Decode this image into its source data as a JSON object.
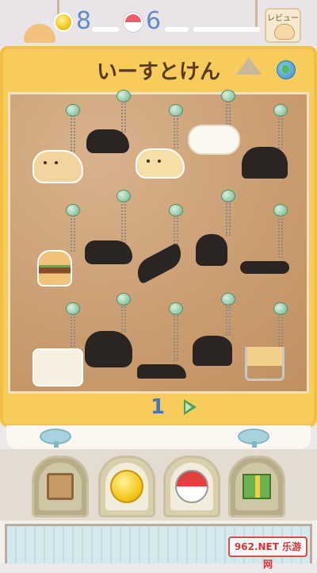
{
  "header": {
    "coins": "8",
    "gachas": "6",
    "review_label": "レビュー"
  },
  "title": "いーすとけん",
  "page": {
    "number": "1"
  },
  "collection": {
    "items": [
      {
        "row": 0,
        "col": 0,
        "state": "owned"
      },
      {
        "row": 0,
        "col": 1,
        "state": "locked"
      },
      {
        "row": 0,
        "col": 2,
        "state": "owned"
      },
      {
        "row": 0,
        "col": 3,
        "state": "owned"
      },
      {
        "row": 1,
        "col": 0,
        "state": "locked"
      },
      {
        "row": 1,
        "col": 1,
        "state": "owned"
      },
      {
        "row": 1,
        "col": 2,
        "state": "locked"
      },
      {
        "row": 1,
        "col": 3,
        "state": "locked"
      },
      {
        "row": 1,
        "col": 4,
        "state": "locked"
      },
      {
        "row": 2,
        "col": 0,
        "state": "owned"
      },
      {
        "row": 2,
        "col": 1,
        "state": "locked"
      },
      {
        "row": 2,
        "col": 2,
        "state": "locked"
      },
      {
        "row": 2,
        "col": 3,
        "state": "locked"
      },
      {
        "row": 2,
        "col": 4,
        "state": "owned"
      }
    ]
  },
  "watermark": "962.NET 乐游网",
  "colors": {
    "frame": "#f7cc5a",
    "board": "#cfa57c",
    "counter": "#5c8dcb",
    "silhouette": "#2a2422"
  },
  "icons": {
    "coin": "coin-icon",
    "gacha": "gacha-capsule-icon",
    "globe": "globe-icon",
    "next": "next-arrow-icon"
  }
}
